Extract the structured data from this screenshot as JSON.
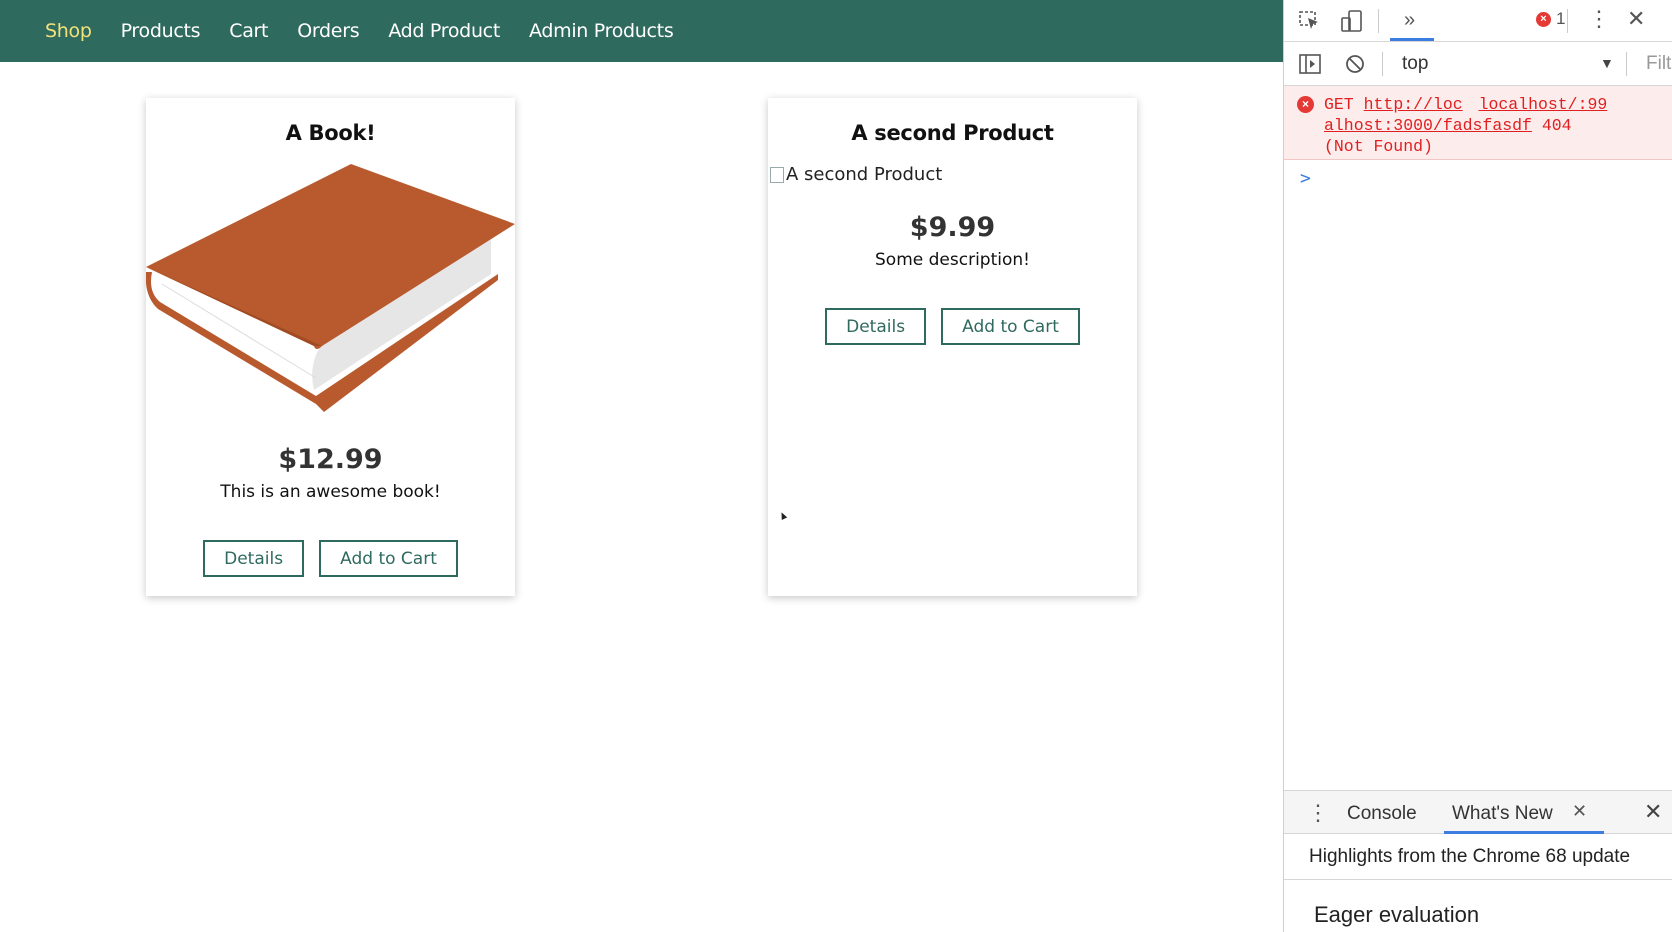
{
  "nav": {
    "items": [
      "Shop",
      "Products",
      "Cart",
      "Orders",
      "Add Product",
      "Admin Products"
    ],
    "active": "Shop"
  },
  "products": [
    {
      "title": "A Book!",
      "price": "$12.99",
      "description": "This is an awesome book!",
      "details_label": "Details",
      "cart_label": "Add to Cart"
    },
    {
      "title": "A second Product",
      "image_alt": "A second Product",
      "price": "$9.99",
      "description": "Some description!",
      "details_label": "Details",
      "cart_label": "Add to Cart"
    }
  ],
  "devtools": {
    "error_count": "1",
    "context": "top",
    "filter_placeholder": "Filt",
    "console_error": {
      "method": "GET",
      "url_line1": "http://loc",
      "source_line1": "localhost/:99",
      "url_line2": "alhost:3000/fadsfasdf",
      "status": "404",
      "status_text": "(Not Found)"
    },
    "prompt": ">",
    "drawer": {
      "tabs": [
        "Console",
        "What's New"
      ],
      "highlights": "Highlights from the Chrome 68 update",
      "section": "Eager evaluation"
    },
    "colors": {
      "accent": "#3b7de0",
      "error": "#e02020",
      "nav_bg": "#2f6a5e",
      "nav_active": "#f3e17a"
    }
  }
}
